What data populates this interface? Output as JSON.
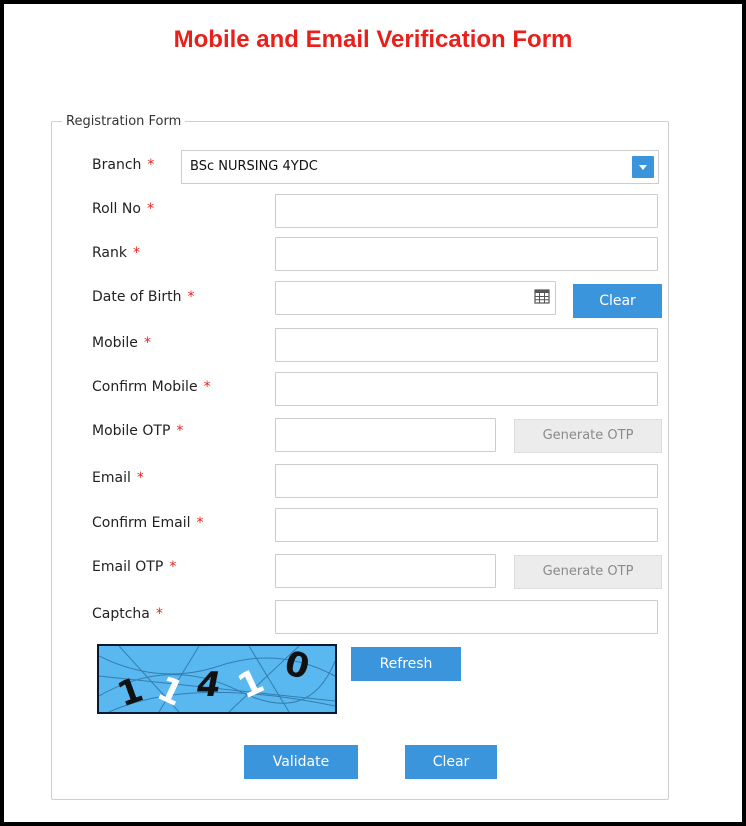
{
  "page_title": "Mobile and Email Verification Form",
  "form": {
    "legend": "Registration Form",
    "branch": {
      "label": "Branch",
      "value": "BSc NURSING 4YDC"
    },
    "roll_no": {
      "label": "Roll No",
      "value": ""
    },
    "rank": {
      "label": "Rank",
      "value": ""
    },
    "dob": {
      "label": "Date of Birth",
      "value": "",
      "clear_label": "Clear"
    },
    "mobile": {
      "label": "Mobile",
      "value": ""
    },
    "confirm_mobile": {
      "label": "Confirm Mobile",
      "value": ""
    },
    "mobile_otp": {
      "label": "Mobile OTP",
      "value": "",
      "generate_label": "Generate OTP"
    },
    "email": {
      "label": "Email",
      "value": ""
    },
    "confirm_email": {
      "label": "Confirm Email",
      "value": ""
    },
    "email_otp": {
      "label": "Email OTP",
      "value": "",
      "generate_label": "Generate OTP"
    },
    "captcha": {
      "label": "Captcha",
      "value": "",
      "image_text": "11410",
      "refresh_label": "Refresh"
    },
    "required_marker": "*",
    "validate_label": "Validate",
    "clear_label": "Clear"
  },
  "colors": {
    "accent": "#3b95dd",
    "required": "#e8201c",
    "title": "#e8201c"
  },
  "icons": {
    "select_arrow": "chevron-down-icon",
    "calendar": "calendar-icon"
  }
}
